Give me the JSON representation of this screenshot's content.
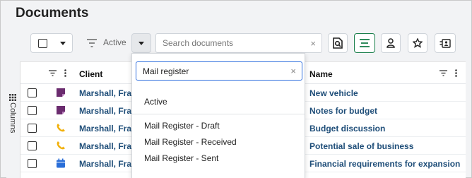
{
  "page": {
    "title": "Documents"
  },
  "toolbar": {
    "filter_label": "Active",
    "search_placeholder": "Search documents",
    "clear_glyph": "×"
  },
  "grid": {
    "side_tab_label": "Columns",
    "columns": {
      "client": "Client",
      "name": "Name"
    },
    "rows": [
      {
        "icon": "note-icon",
        "icon_color": "#6b2c6f",
        "client": "Marshall, Frank",
        "name": "New vehicle"
      },
      {
        "icon": "note-icon",
        "icon_color": "#6b2c6f",
        "client": "Marshall, Frank",
        "name": "Notes for budget"
      },
      {
        "icon": "phone-icon",
        "icon_color": "#f2b10c",
        "client": "Marshall, Frank",
        "name": "Budget discussion"
      },
      {
        "icon": "phone-icon",
        "icon_color": "#f2b10c",
        "client": "Marshall, Frank",
        "name": "Potential sale of business"
      },
      {
        "icon": "calendar-icon",
        "icon_color": "#2a6ed8",
        "client": "Marshall, Frank",
        "name": "Financial requirements for expansion"
      }
    ]
  },
  "dropdown": {
    "search_value": "Mail register",
    "items": [
      "Active",
      "Mail Register - Draft",
      "Mail Register - Received",
      "Mail Register - Sent"
    ]
  },
  "colors": {
    "accent_green": "#1a7f4b",
    "accent_blue": "#2f6fde",
    "link_blue": "#1f4e79"
  }
}
